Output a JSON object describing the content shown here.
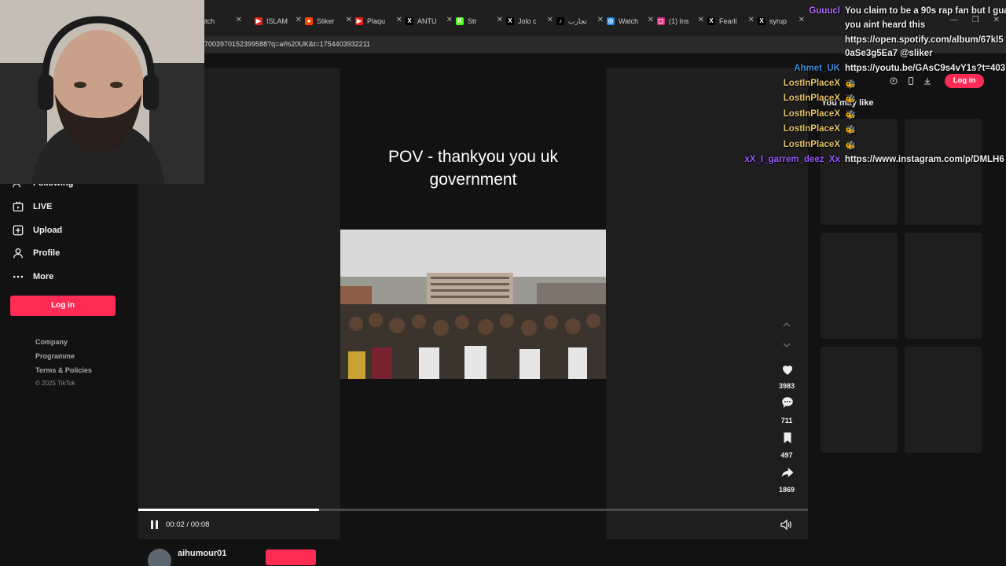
{
  "browser": {
    "tabs": [
      {
        "label": "Watch",
        "color": "#888888",
        "glyph": ""
      },
      {
        "label": "ISLAM",
        "color": "#e62117",
        "glyph": "▶"
      },
      {
        "label": "Sliker",
        "color": "#ff4500",
        "glyph": "●"
      },
      {
        "label": "Plaqu",
        "color": "#e62117",
        "glyph": "▶"
      },
      {
        "label": "ANTU",
        "color": "#000000",
        "glyph": "X"
      },
      {
        "label": "Str",
        "color": "#53fc18",
        "glyph": "K"
      },
      {
        "label": "Jolo c",
        "color": "#000000",
        "glyph": "X"
      },
      {
        "label": "تجارب",
        "color": "#000000",
        "glyph": "♪"
      },
      {
        "label": "Watch",
        "color": "#1e88e5",
        "glyph": "◎"
      },
      {
        "label": "(1) Ins",
        "color": "#d62976",
        "glyph": "◻"
      },
      {
        "label": "Fearli",
        "color": "#000000",
        "glyph": "X"
      },
      {
        "label": "syrup",
        "color": "#000000",
        "glyph": "X"
      }
    ],
    "url": "7003970152399588?q=ai%20UK&t=1754403932211"
  },
  "sidebar": {
    "items": [
      {
        "label": "Following",
        "icon": "following-icon"
      },
      {
        "label": "LIVE",
        "icon": "live-icon"
      },
      {
        "label": "Upload",
        "icon": "upload-icon"
      },
      {
        "label": "Profile",
        "icon": "profile-icon"
      },
      {
        "label": "More",
        "icon": "more-icon"
      }
    ],
    "login_label": "Log in",
    "footer_links": [
      "Company",
      "Programme",
      "Terms & Policies"
    ],
    "copyright": "© 2025 TikTok"
  },
  "video": {
    "caption_line1": "POV - thankyou you uk",
    "caption_line2": "government",
    "time": "00:02 / 00:08",
    "progress_fraction": 0.27,
    "author": "aihumour01"
  },
  "actions": {
    "likes": "3983",
    "comments": "711",
    "saves": "497",
    "shares": "1869"
  },
  "right_panel": {
    "login_label": "Log in",
    "may_like": "You may like"
  },
  "chat": [
    {
      "user": "Guuucl",
      "color": "#b56cff",
      "msg": "You claim to be a 90s rap fan but I gua"
    },
    {
      "user": "",
      "color": "#b56cff",
      "msg": "you aint heard this"
    },
    {
      "user": "",
      "color": "#b56cff",
      "msg": "https://open.spotify.com/album/67kl5"
    },
    {
      "user": "",
      "color": "#b56cff",
      "msg": "0aSe3g5Ea7 @sliker"
    },
    {
      "user": "Ahmet_UK",
      "color": "#3f8ad8",
      "msg": "https://youtu.be/GAsC9s4vY1s?t=403"
    },
    {
      "user": "LostInPlaceX",
      "color": "#e8c36a",
      "msg": "🐝"
    },
    {
      "user": "LostInPlaceX",
      "color": "#e8c36a",
      "msg": "🐝"
    },
    {
      "user": "LostInPlaceX",
      "color": "#e8c36a",
      "msg": "🐝"
    },
    {
      "user": "LostInPlaceX",
      "color": "#e8c36a",
      "msg": "🐝"
    },
    {
      "user": "LostInPlaceX",
      "color": "#e8c36a",
      "msg": "🐝"
    },
    {
      "user": "xX_I_garrem_deez_Xx",
      "color": "#9b59ff",
      "msg": "https://www.instagram.com/p/DMLH6"
    }
  ]
}
